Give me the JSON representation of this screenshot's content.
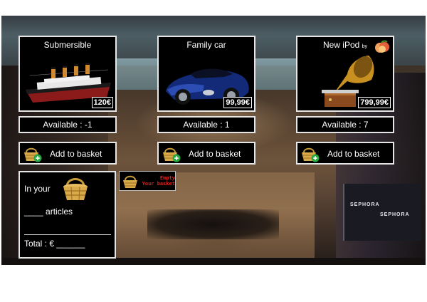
{
  "products": [
    {
      "title": "Submersible",
      "price": "120€",
      "available": "Available : -1",
      "add_label": "Add to basket",
      "image": "ship-picture"
    },
    {
      "title": "Family car",
      "price": "99,99€",
      "available": "Available : 1",
      "add_label": "Add to basket",
      "image": "sports-car-picture"
    },
    {
      "title": "New iPod",
      "title_suffix": "by",
      "price": "799,99€",
      "available": "Available : 7",
      "add_label": "Add to basket",
      "image": "gramophone-picture"
    }
  ],
  "basket": {
    "line1": "In your",
    "line2": "____ articles",
    "line3": "Total : € ______",
    "icon": "basket-icon"
  },
  "empty_button": {
    "line1": "Empty",
    "line2": "Your basket",
    "icon": "basket-icon"
  },
  "colors": {
    "panel_bg": "#000000",
    "panel_border": "#e6e6e6",
    "empty_text": "#e02020",
    "plus_badge": "#27a843"
  }
}
